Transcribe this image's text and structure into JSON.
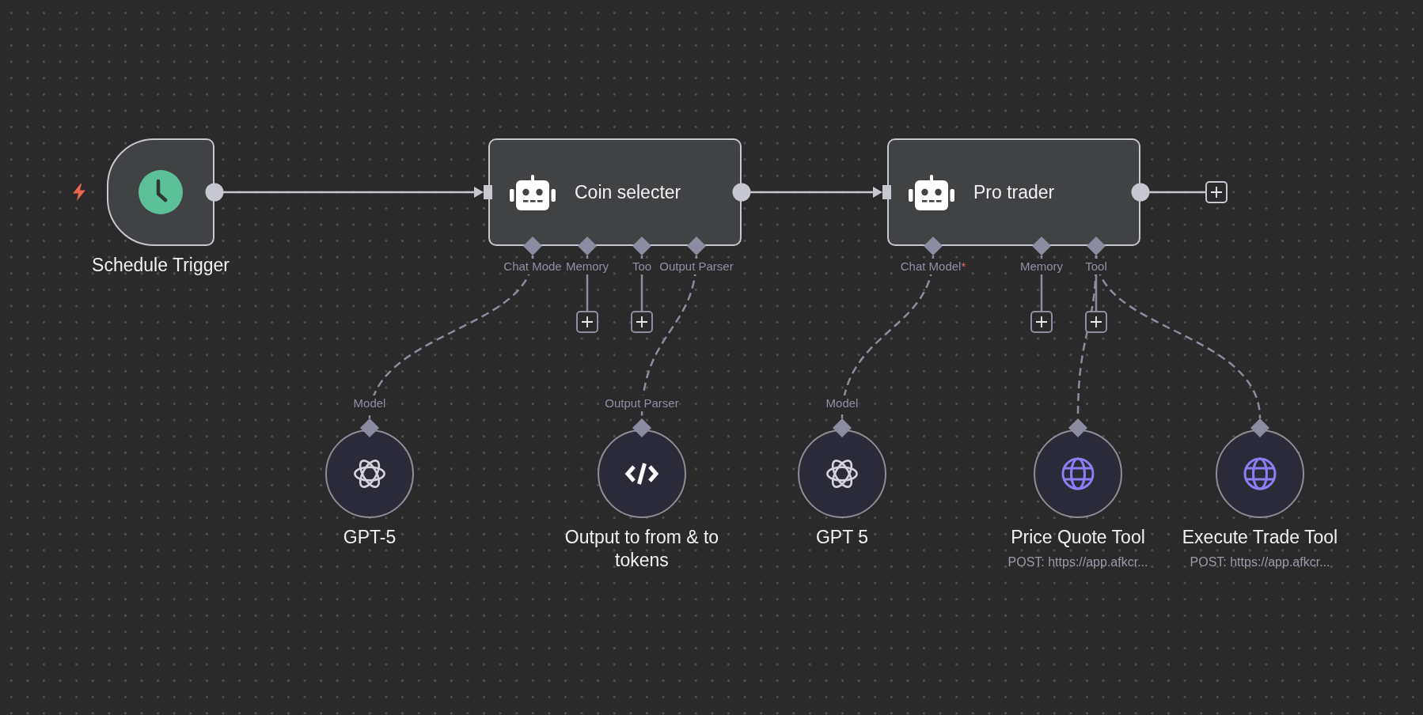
{
  "workflow": {
    "nodes": [
      {
        "kind": "trigger",
        "name": "Schedule Trigger"
      },
      {
        "kind": "agent",
        "name": "Coin selecter",
        "output_add_button": false,
        "ports": [
          {
            "label": "Chat Mode",
            "add_button": false,
            "attached": [
              {
                "kind": "model",
                "port_label": "Model",
                "name": "GPT-5"
              }
            ]
          },
          {
            "label": "Memory",
            "add_button": true
          },
          {
            "label": "Too",
            "add_button": true
          },
          {
            "label": "Output Parser",
            "add_button": false,
            "attached": [
              {
                "kind": "parser",
                "port_label": "Output Parser",
                "name": "Output to from & to tokens"
              }
            ]
          }
        ]
      },
      {
        "kind": "agent",
        "name": "Pro trader",
        "output_add_button": true,
        "ports": [
          {
            "label": "Chat Model",
            "required_mark": "*",
            "add_button": false,
            "attached": [
              {
                "kind": "model",
                "port_label": "Model",
                "name": "GPT 5"
              }
            ]
          },
          {
            "label": "Memory",
            "add_button": true
          },
          {
            "label": "Tool",
            "add_button": true,
            "attached": [
              {
                "kind": "tool",
                "name": "Price Quote Tool",
                "subtitle": "POST: https://app.afkcr..."
              },
              {
                "kind": "tool",
                "name": "Execute Trade Tool",
                "subtitle": "POST: https://app.afkcr..."
              }
            ]
          }
        ]
      }
    ]
  }
}
